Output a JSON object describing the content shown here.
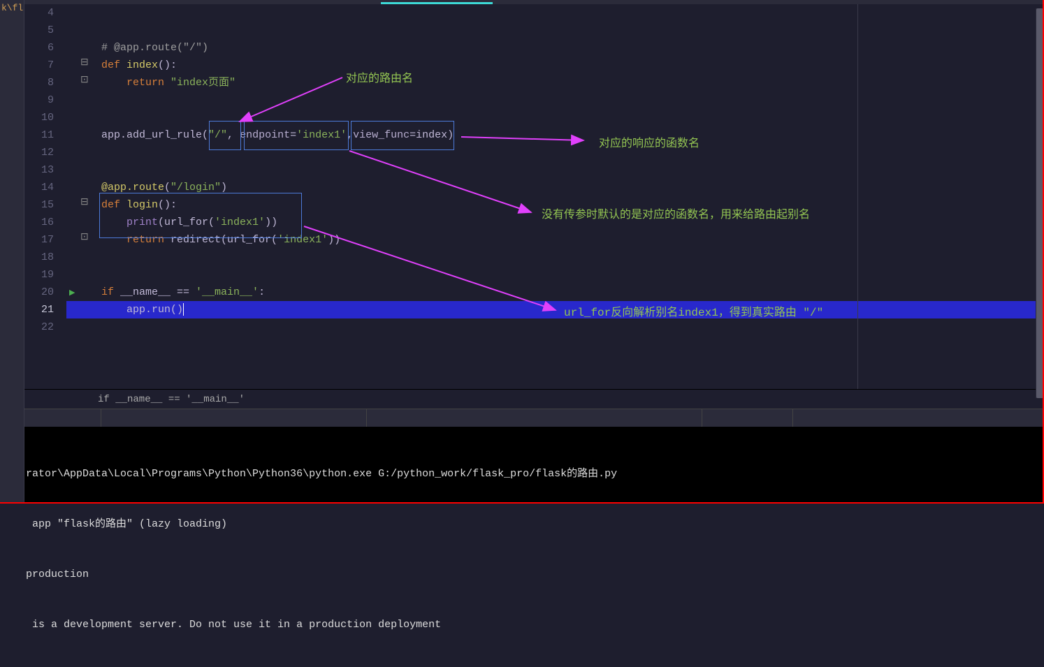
{
  "sidebar": {
    "tab_text": "k\\fla"
  },
  "gutter": {
    "start": 4,
    "end": 22
  },
  "current_line": 21,
  "run_gutter_line": 20,
  "ruler_cols": [
    120
  ],
  "code": {
    "l4": "",
    "l5": "",
    "l6_comment": "# @app.route(\"/\")",
    "l7_def": "def",
    "l7_name": "index",
    "l7_paren": "():",
    "l8_return": "return",
    "l8_str": "\"index页面\"",
    "l9": "",
    "l10": "",
    "l11_pre": "app.add_url_rule(",
    "l11_s1": "\"/\"",
    "l11_c1": ", ",
    "l11_kw": "endpoint",
    "l11_eq": "=",
    "l11_s2": "'index1'",
    "l11_c2": ",",
    "l11_vf": "view_func",
    "l11_eq2": "=",
    "l11_idx": "index",
    "l11_end": ")",
    "l12": "",
    "l13": "",
    "l14_deco": "@app.route",
    "l14_arg": "\"/login\"",
    "l15_def": "def",
    "l15_name": "login",
    "l15_paren": "():",
    "l16_print": "print",
    "l16_mid": "(url_for(",
    "l16_str": "'index1'",
    "l16_end": "))",
    "l17_return": "return",
    "l17_mid": " redirect(url_for(",
    "l17_str": "'index1'",
    "l17_end": "))",
    "l18": "",
    "l19": "",
    "l20_if": "if",
    "l20_name": " __name__ ",
    "l20_eq": "==",
    "l20_str": " '__main__'",
    "l20_colon": ":",
    "l21_pre": "    app.run(",
    "l21_end": ")"
  },
  "annotations": {
    "a1": "对应的路由名",
    "a2": "对应的响应的函数名",
    "a3": "没有传参时默认的是对应的函数名，用来给路由起别名",
    "a4": "url_for反向解析别名index1，得到真实路由 \"/\""
  },
  "breadcrumb": "if __name__ == '__main__'",
  "terminal": {
    "lines": [
      "rator\\AppData\\Local\\Programs\\Python\\Python36\\python.exe G:/python_work/flask_pro/flask的路由.py",
      " app \"flask的路由\" (lazy loading)",
      "production",
      " is a development server. Do not use it in a production deployment"
    ]
  }
}
